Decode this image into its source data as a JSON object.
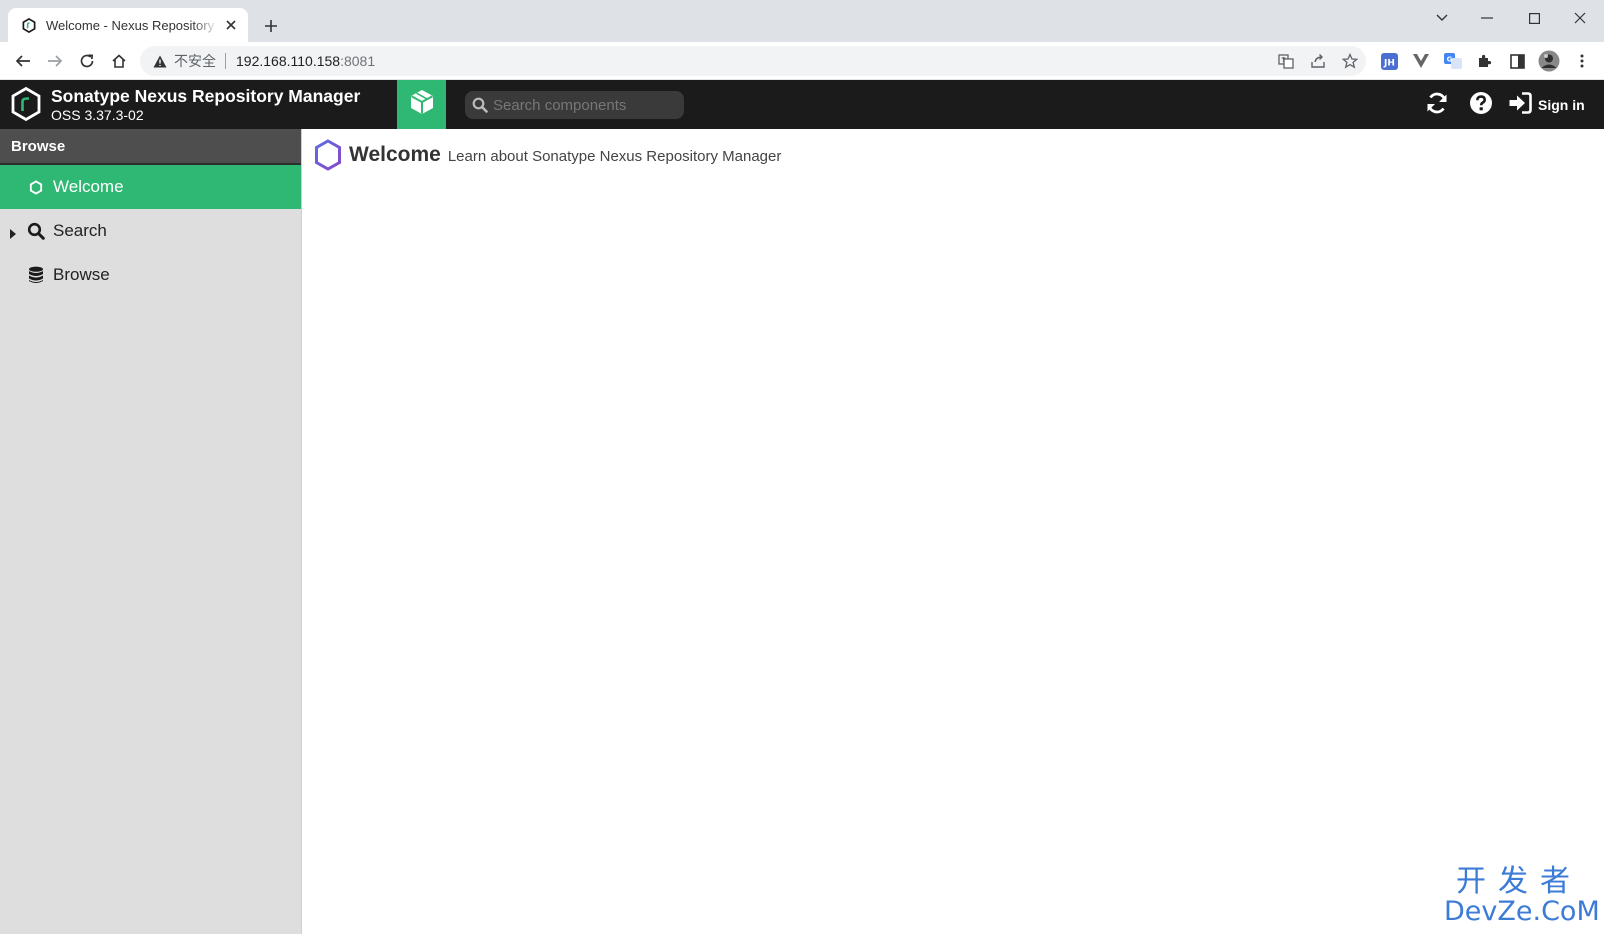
{
  "browser": {
    "tab_title": "Welcome - Nexus Repository Manager",
    "insecure_label": "不安全",
    "url_host": "192.168.110.158",
    "url_port": ":8081"
  },
  "header": {
    "title": "Sonatype Nexus Repository Manager",
    "version": "OSS 3.37.3-02",
    "search_placeholder": "Search components",
    "signin_label": "Sign in",
    "colors": {
      "header_bg": "#1b1b1b",
      "accent": "#2fb874"
    }
  },
  "sidebar": {
    "header": "Browse",
    "items": [
      {
        "label": "Welcome",
        "icon": "hexagon-icon",
        "active": true
      },
      {
        "label": "Search",
        "icon": "search-icon",
        "expandable": true
      },
      {
        "label": "Browse",
        "icon": "database-icon"
      }
    ]
  },
  "main": {
    "title": "Welcome",
    "subtitle": "Learn about Sonatype Nexus Repository Manager"
  },
  "watermark": {
    "line1": "开发者",
    "line2": "DevZe.CoM"
  }
}
